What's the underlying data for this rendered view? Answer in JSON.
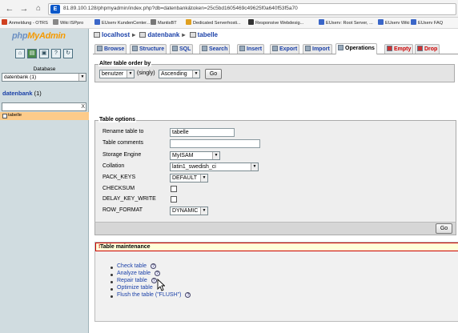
{
  "browser": {
    "url": "81.89.100.128/phpmyadmin/index.php?db=datenbank&token=25c5bd1605469c49625f0a640f53f5a70",
    "url_host": "81.89.100.128",
    "bookmarks": [
      {
        "label": "Anmeldung - OTRS",
        "color": "#d04020"
      },
      {
        "label": "Wiki ISPpro",
        "color": "#888888"
      },
      {
        "label": "EUserv KundenCenter...",
        "color": "#3a66c8"
      },
      {
        "label": "MantisBT",
        "color": "#777777"
      },
      {
        "label": "Dedicated Serverhosti...",
        "color": "#e0a020"
      },
      {
        "label": "Responsive Webdesig...",
        "color": "#333333"
      },
      {
        "label": "EUserv: Root Server, ...",
        "color": "#3a66c8"
      },
      {
        "label": "EUserv Wiki",
        "color": "#3a66c8"
      },
      {
        "label": "EUserv FAQ",
        "color": "#3a66c8"
      }
    ]
  },
  "sidebar": {
    "logo_php": "php",
    "logo_myadmin": "MyAdmin",
    "database_label": "Database",
    "database_select": "datenbank (1)",
    "db_title": "datenbank",
    "db_count": "(1)",
    "filter_clear": "X",
    "tables": [
      "tabelle"
    ]
  },
  "breadcrumb": {
    "server": "localhost",
    "database": "datenbank",
    "table": "tabelle"
  },
  "tabs": [
    {
      "label": "Browse"
    },
    {
      "label": "Structure"
    },
    {
      "label": "SQL"
    },
    {
      "label": "Search"
    },
    {
      "label": "Insert"
    },
    {
      "label": "Export"
    },
    {
      "label": "Import"
    },
    {
      "label": "Operations"
    },
    {
      "label": "Empty"
    },
    {
      "label": "Drop"
    }
  ],
  "order": {
    "legend": "Alter table order by",
    "column": "benutzer",
    "singly": "(singly)",
    "direction": "Ascending",
    "go": "Go"
  },
  "options": {
    "legend": "Table options",
    "rename_label": "Rename table to",
    "rename_value": "tabelle",
    "comments_label": "Table comments",
    "comments_value": "",
    "engine_label": "Storage Engine",
    "engine_value": "MyISAM",
    "collation_label": "Collation",
    "collation_value": "latin1_swedish_ci",
    "pack_keys_label": "PACK_KEYS",
    "pack_keys_value": "DEFAULT",
    "checksum_label": "CHECKSUM",
    "delay_key_write_label": "DELAY_KEY_WRITE",
    "row_format_label": "ROW_FORMAT",
    "row_format_value": "DYNAMIC",
    "go": "Go"
  },
  "maintenance": {
    "legend": "Table maintenance",
    "links": [
      {
        "label": "Check table"
      },
      {
        "label": "Analyze table"
      },
      {
        "label": "Repair table"
      },
      {
        "label": "Optimize table"
      },
      {
        "label": "Flush the table (\"FLUSH\")"
      }
    ],
    "help": "?"
  }
}
